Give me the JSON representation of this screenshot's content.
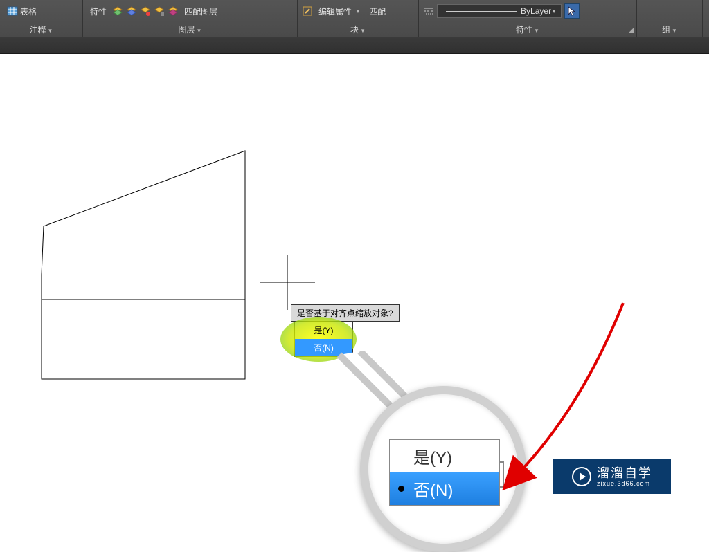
{
  "ribbon": {
    "annotation": {
      "table_label": "表格",
      "title": "注释"
    },
    "layers": {
      "properties_label": "特性",
      "match_layer_label": "匹配图层",
      "title": "图层"
    },
    "block": {
      "edit_attr_label": "编辑属性",
      "match_label": "匹配",
      "title": "块"
    },
    "properties": {
      "bylayer_label": "ByLayer",
      "title": "特性"
    },
    "group": {
      "title": "组"
    }
  },
  "prompt": {
    "question": "是否基于对齐点缩放对象?",
    "yes": "是(Y)",
    "no": "否(N)"
  },
  "magnifier": {
    "yes": "是(Y)",
    "no": "否(N)"
  },
  "watermark": {
    "main": "溜溜自学",
    "sub": "zixue.3d66.com"
  }
}
